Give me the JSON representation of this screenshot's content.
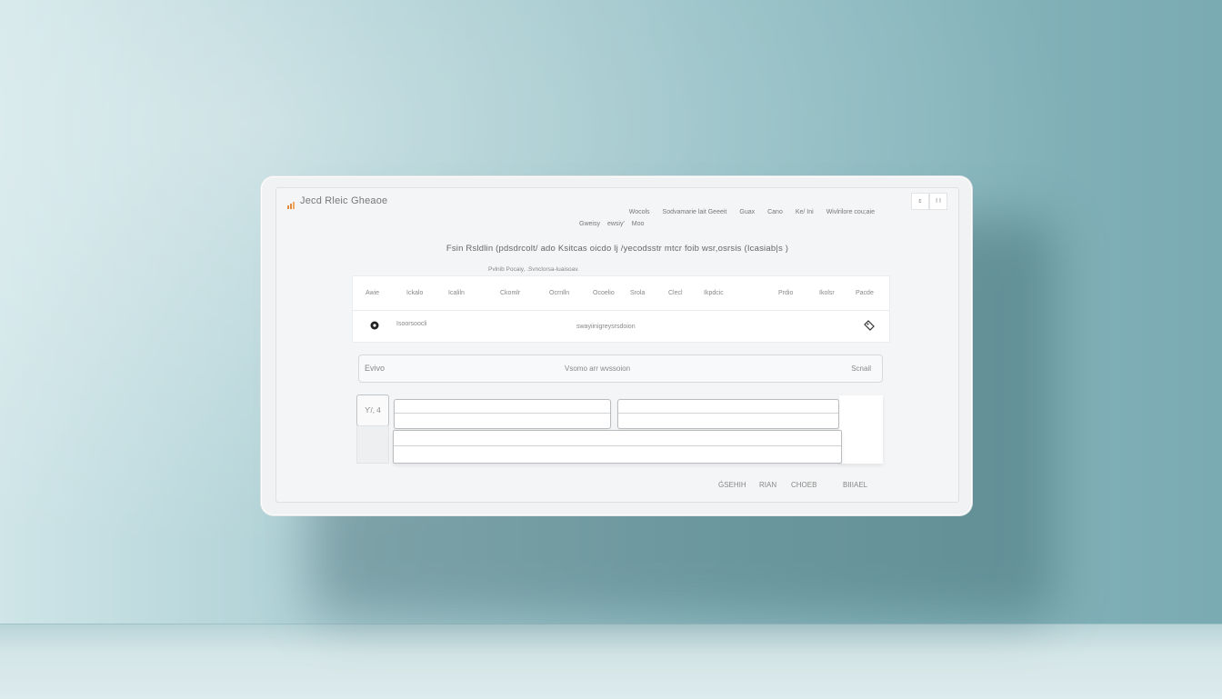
{
  "app": {
    "brand_name": "Jecd Rleic Gheaoe",
    "brand_icon": "chart-logo-icon",
    "accent_color": "#e28a3b"
  },
  "window_controls": [
    "ɛ",
    "I I"
  ],
  "nav": [
    "Wocols",
    "Sodvamarie lait Geeeit",
    "Guax",
    "Cano",
    "Ke/ Ini",
    "Wivlrilore cou;aie"
  ],
  "subnav": [
    "Gweisy",
    "ewsiy'",
    "Moo"
  ],
  "headline": "Fsin Rsldlin (pdsdrcolt/ ado Ksitcas oicdo lj /yecodsstr mtcr foib wsr,osrsis (Icasiab|s )",
  "subline": "Pvlnib Pocaiy, .Svnclorsa-luaisoav.",
  "table": {
    "columns": [
      "Awie",
      "Ickalo",
      "Icaliln",
      "Ckomlr",
      "Ocrnlln",
      "Ocoelio",
      "Srola",
      "Clecl",
      "Ikpdcic",
      "Prdio",
      "Ikolsr",
      "Pacde"
    ],
    "row": {
      "icon": "circle-bullet-icon",
      "label": "Isoorsoocli",
      "center_text": "swayiinigreysrsdoion",
      "action_icon": "tag-icon"
    }
  },
  "bar": {
    "left": "Evivo",
    "center": "Vsomo arr wvssoion",
    "right": "Scnail"
  },
  "form": {
    "side_button": "Ƴ/, 4"
  },
  "footer": [
    "ǴSEHIH",
    "RIAN",
    "CHOEB",
    "BIIIAEL"
  ]
}
